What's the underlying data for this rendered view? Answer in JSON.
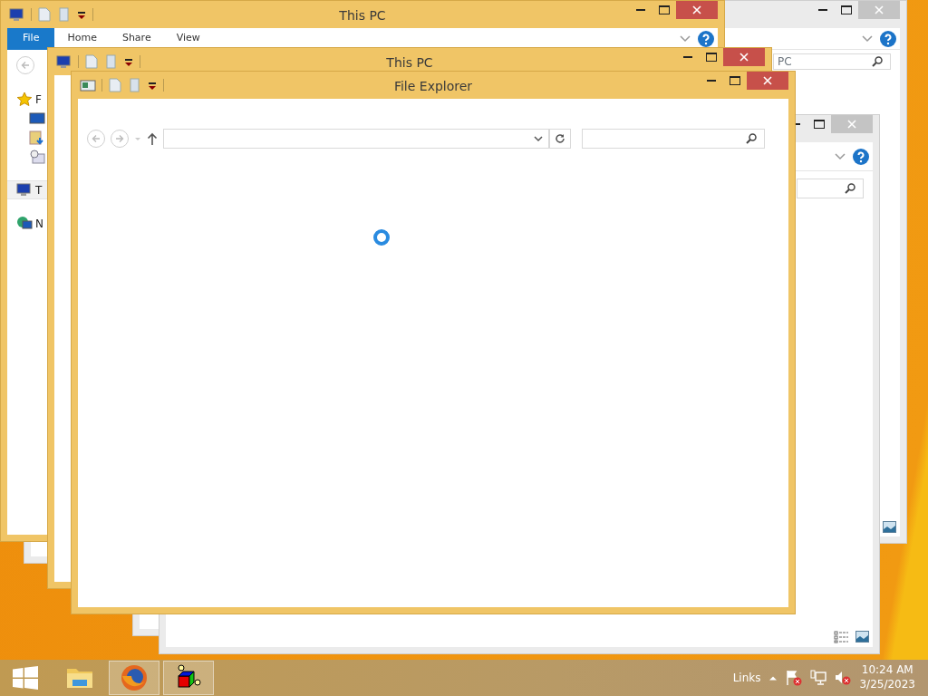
{
  "windows": [
    {
      "kind": "blank"
    },
    {
      "kind": "blank"
    },
    {
      "kind": "inactive",
      "search_text": "PC"
    },
    {
      "kind": "inactive"
    },
    {
      "kind": "active",
      "title": "This PC",
      "tabs": [
        {
          "label": "File",
          "selected": true
        },
        {
          "label": "Home",
          "selected": false
        },
        {
          "label": "Share",
          "selected": false
        },
        {
          "label": "View",
          "selected": false
        }
      ],
      "nav_items": [
        {
          "kind": "star",
          "label": "F",
          "selected": false
        },
        {
          "kind": "desktop",
          "selected": false
        },
        {
          "kind": "downloads",
          "selected": false
        },
        {
          "kind": "recent",
          "selected": false
        },
        {
          "kind": "computer",
          "label": "T",
          "selected": true
        },
        {
          "kind": "network",
          "label": "N",
          "selected": false
        }
      ]
    },
    {
      "kind": "active",
      "title": "This PC"
    },
    {
      "kind": "active",
      "title": "File Explorer",
      "loading": true
    }
  ],
  "taskbar": {
    "apps": [
      {
        "kind": "folder",
        "running": false
      },
      {
        "kind": "firefox",
        "running": true
      },
      {
        "kind": "cube",
        "running": true
      }
    ],
    "tray": {
      "links": "Links",
      "time": "10:24 AM",
      "date": "3/25/2023"
    }
  }
}
